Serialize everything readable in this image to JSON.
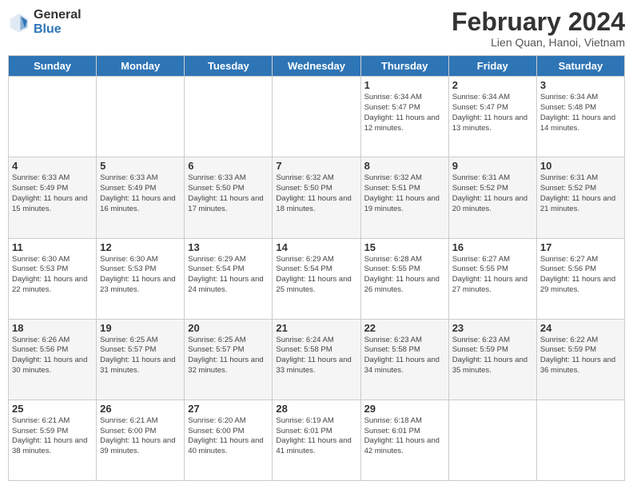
{
  "header": {
    "logo": {
      "line1": "General",
      "line2": "Blue"
    },
    "title": "February 2024",
    "subtitle": "Lien Quan, Hanoi, Vietnam"
  },
  "weekdays": [
    "Sunday",
    "Monday",
    "Tuesday",
    "Wednesday",
    "Thursday",
    "Friday",
    "Saturday"
  ],
  "weeks": [
    [
      {
        "day": "",
        "sunrise": "",
        "sunset": "",
        "daylight": ""
      },
      {
        "day": "",
        "sunrise": "",
        "sunset": "",
        "daylight": ""
      },
      {
        "day": "",
        "sunrise": "",
        "sunset": "",
        "daylight": ""
      },
      {
        "day": "",
        "sunrise": "",
        "sunset": "",
        "daylight": ""
      },
      {
        "day": "1",
        "sunrise": "Sunrise: 6:34 AM",
        "sunset": "Sunset: 5:47 PM",
        "daylight": "Daylight: 11 hours and 12 minutes."
      },
      {
        "day": "2",
        "sunrise": "Sunrise: 6:34 AM",
        "sunset": "Sunset: 5:47 PM",
        "daylight": "Daylight: 11 hours and 13 minutes."
      },
      {
        "day": "3",
        "sunrise": "Sunrise: 6:34 AM",
        "sunset": "Sunset: 5:48 PM",
        "daylight": "Daylight: 11 hours and 14 minutes."
      }
    ],
    [
      {
        "day": "4",
        "sunrise": "Sunrise: 6:33 AM",
        "sunset": "Sunset: 5:49 PM",
        "daylight": "Daylight: 11 hours and 15 minutes."
      },
      {
        "day": "5",
        "sunrise": "Sunrise: 6:33 AM",
        "sunset": "Sunset: 5:49 PM",
        "daylight": "Daylight: 11 hours and 16 minutes."
      },
      {
        "day": "6",
        "sunrise": "Sunrise: 6:33 AM",
        "sunset": "Sunset: 5:50 PM",
        "daylight": "Daylight: 11 hours and 17 minutes."
      },
      {
        "day": "7",
        "sunrise": "Sunrise: 6:32 AM",
        "sunset": "Sunset: 5:50 PM",
        "daylight": "Daylight: 11 hours and 18 minutes."
      },
      {
        "day": "8",
        "sunrise": "Sunrise: 6:32 AM",
        "sunset": "Sunset: 5:51 PM",
        "daylight": "Daylight: 11 hours and 19 minutes."
      },
      {
        "day": "9",
        "sunrise": "Sunrise: 6:31 AM",
        "sunset": "Sunset: 5:52 PM",
        "daylight": "Daylight: 11 hours and 20 minutes."
      },
      {
        "day": "10",
        "sunrise": "Sunrise: 6:31 AM",
        "sunset": "Sunset: 5:52 PM",
        "daylight": "Daylight: 11 hours and 21 minutes."
      }
    ],
    [
      {
        "day": "11",
        "sunrise": "Sunrise: 6:30 AM",
        "sunset": "Sunset: 5:53 PM",
        "daylight": "Daylight: 11 hours and 22 minutes."
      },
      {
        "day": "12",
        "sunrise": "Sunrise: 6:30 AM",
        "sunset": "Sunset: 5:53 PM",
        "daylight": "Daylight: 11 hours and 23 minutes."
      },
      {
        "day": "13",
        "sunrise": "Sunrise: 6:29 AM",
        "sunset": "Sunset: 5:54 PM",
        "daylight": "Daylight: 11 hours and 24 minutes."
      },
      {
        "day": "14",
        "sunrise": "Sunrise: 6:29 AM",
        "sunset": "Sunset: 5:54 PM",
        "daylight": "Daylight: 11 hours and 25 minutes."
      },
      {
        "day": "15",
        "sunrise": "Sunrise: 6:28 AM",
        "sunset": "Sunset: 5:55 PM",
        "daylight": "Daylight: 11 hours and 26 minutes."
      },
      {
        "day": "16",
        "sunrise": "Sunrise: 6:27 AM",
        "sunset": "Sunset: 5:55 PM",
        "daylight": "Daylight: 11 hours and 27 minutes."
      },
      {
        "day": "17",
        "sunrise": "Sunrise: 6:27 AM",
        "sunset": "Sunset: 5:56 PM",
        "daylight": "Daylight: 11 hours and 29 minutes."
      }
    ],
    [
      {
        "day": "18",
        "sunrise": "Sunrise: 6:26 AM",
        "sunset": "Sunset: 5:56 PM",
        "daylight": "Daylight: 11 hours and 30 minutes."
      },
      {
        "day": "19",
        "sunrise": "Sunrise: 6:25 AM",
        "sunset": "Sunset: 5:57 PM",
        "daylight": "Daylight: 11 hours and 31 minutes."
      },
      {
        "day": "20",
        "sunrise": "Sunrise: 6:25 AM",
        "sunset": "Sunset: 5:57 PM",
        "daylight": "Daylight: 11 hours and 32 minutes."
      },
      {
        "day": "21",
        "sunrise": "Sunrise: 6:24 AM",
        "sunset": "Sunset: 5:58 PM",
        "daylight": "Daylight: 11 hours and 33 minutes."
      },
      {
        "day": "22",
        "sunrise": "Sunrise: 6:23 AM",
        "sunset": "Sunset: 5:58 PM",
        "daylight": "Daylight: 11 hours and 34 minutes."
      },
      {
        "day": "23",
        "sunrise": "Sunrise: 6:23 AM",
        "sunset": "Sunset: 5:59 PM",
        "daylight": "Daylight: 11 hours and 35 minutes."
      },
      {
        "day": "24",
        "sunrise": "Sunrise: 6:22 AM",
        "sunset": "Sunset: 5:59 PM",
        "daylight": "Daylight: 11 hours and 36 minutes."
      }
    ],
    [
      {
        "day": "25",
        "sunrise": "Sunrise: 6:21 AM",
        "sunset": "Sunset: 5:59 PM",
        "daylight": "Daylight: 11 hours and 38 minutes."
      },
      {
        "day": "26",
        "sunrise": "Sunrise: 6:21 AM",
        "sunset": "Sunset: 6:00 PM",
        "daylight": "Daylight: 11 hours and 39 minutes."
      },
      {
        "day": "27",
        "sunrise": "Sunrise: 6:20 AM",
        "sunset": "Sunset: 6:00 PM",
        "daylight": "Daylight: 11 hours and 40 minutes."
      },
      {
        "day": "28",
        "sunrise": "Sunrise: 6:19 AM",
        "sunset": "Sunset: 6:01 PM",
        "daylight": "Daylight: 11 hours and 41 minutes."
      },
      {
        "day": "29",
        "sunrise": "Sunrise: 6:18 AM",
        "sunset": "Sunset: 6:01 PM",
        "daylight": "Daylight: 11 hours and 42 minutes."
      },
      {
        "day": "",
        "sunrise": "",
        "sunset": "",
        "daylight": ""
      },
      {
        "day": "",
        "sunrise": "",
        "sunset": "",
        "daylight": ""
      }
    ]
  ]
}
